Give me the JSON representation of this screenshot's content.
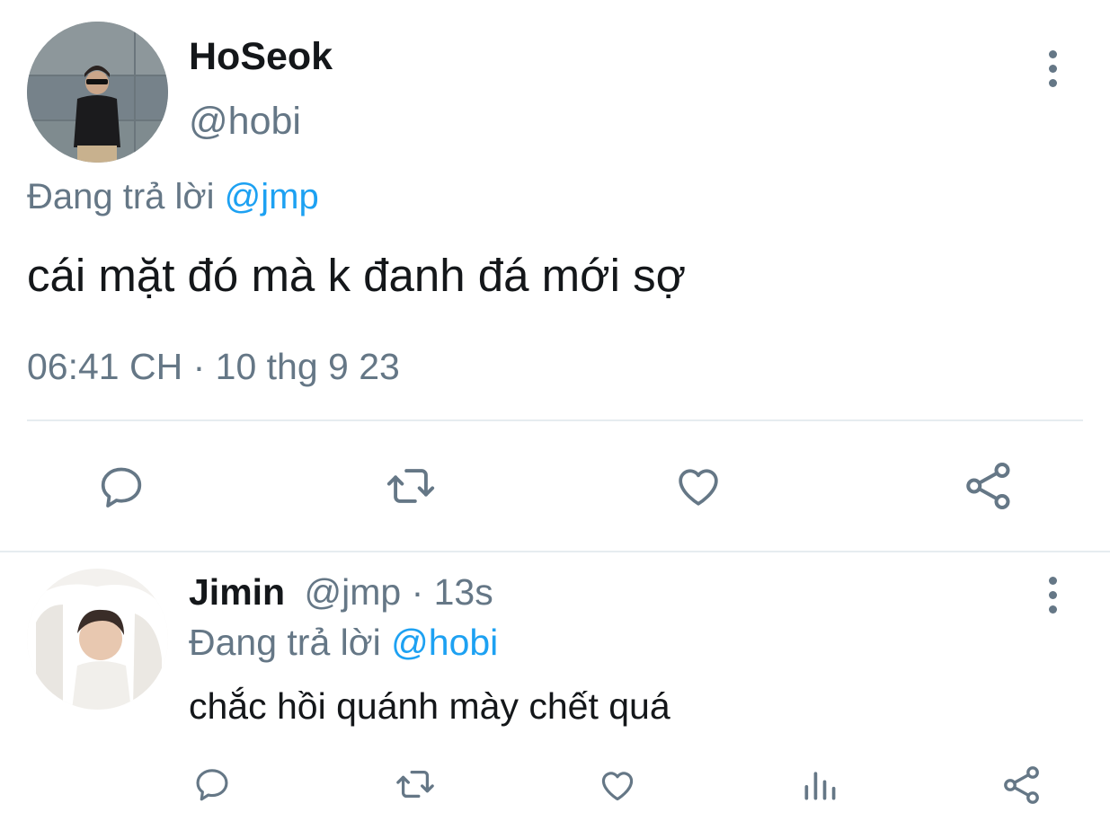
{
  "main_tweet": {
    "display_name": "HoSeok",
    "handle": "@hobi",
    "reply_prefix": "Đang trả lời",
    "reply_to": "@jmp",
    "text": "cái mặt đó mà k đanh đá mới sợ",
    "timestamp": "06:41 CH · 10 thg 9 23",
    "icons": {
      "more": "more-vertical-icon",
      "reply": "reply-icon",
      "retweet": "retweet-icon",
      "like": "heart-icon",
      "share": "share-icon"
    }
  },
  "reply_tweet": {
    "display_name": "Jimin",
    "meta": "@jmp · 13s",
    "reply_prefix": "Đang trả lời",
    "reply_to": "@hobi",
    "text": "chắc hồi quánh mày chết quá",
    "icons": {
      "more": "more-vertical-icon",
      "reply": "reply-icon",
      "retweet": "retweet-icon",
      "like": "heart-icon",
      "analytics": "analytics-icon",
      "share": "share-icon"
    }
  },
  "colors": {
    "text": "#14171a",
    "muted": "#657786",
    "link": "#1da1f2",
    "divider": "#e6ecf0"
  }
}
